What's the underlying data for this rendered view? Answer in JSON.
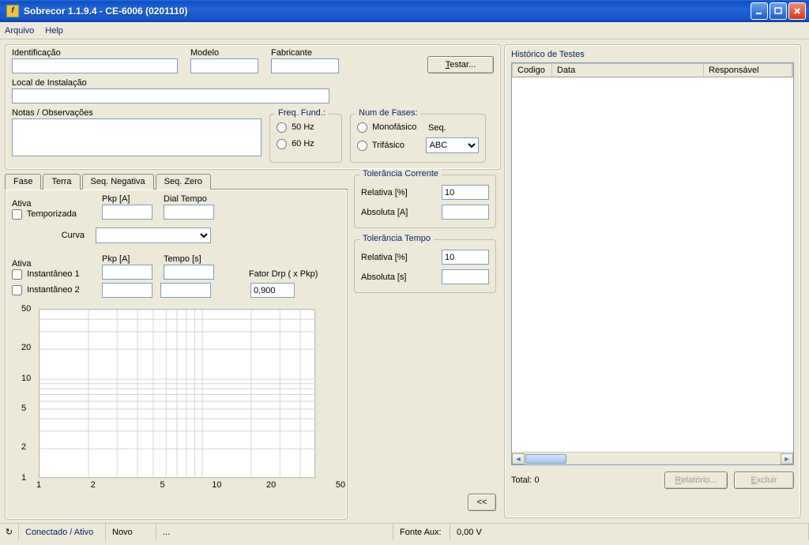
{
  "window": {
    "title": "Sobrecor 1.1.9.4 - CE-6006 (0201110)"
  },
  "menu": {
    "arquivo": "Arquivo",
    "help": "Help"
  },
  "ident": {
    "identificacao_label": "Identificação",
    "identificacao_value": "",
    "modelo_label": "Modelo",
    "modelo_value": "",
    "fabricante_label": "Fabricante",
    "fabricante_value": "",
    "testar_label": "Testar...",
    "local_label": "Local de Instalação",
    "local_value": "",
    "notas_label": "Notas / Observações",
    "notas_value": ""
  },
  "freq": {
    "group": "Freq. Fund.:",
    "opt50": "50 Hz",
    "opt60": "60 Hz"
  },
  "fases": {
    "group": "Num de Fases:",
    "mono": "Monofásico",
    "tri": "Trifásico",
    "seq_label": "Seq.",
    "seq_value": "ABC"
  },
  "tol_cor": {
    "group": "Tolerância Corrente",
    "relativa": "Relativa [%]",
    "relativa_v": "10",
    "absoluta": "Absoluta [A]",
    "absoluta_v": ""
  },
  "tol_tempo": {
    "group": "Tolerância Tempo",
    "relativa": "Relativa [%]",
    "relativa_v": "10",
    "absoluta": "Absoluta [s]",
    "absoluta_v": ""
  },
  "tabs": {
    "fase": "Fase",
    "terra": "Terra",
    "seqneg": "Seq. Negativa",
    "seqzero": "Seq. Zero"
  },
  "phase": {
    "ativa1": "Ativa",
    "temporizada": "Temporizada",
    "pkp": "Pkp [A]",
    "dial": "Dial Tempo",
    "curva": "Curva",
    "ativa2": "Ativa",
    "inst1": "Instantâneo 1",
    "inst2": "Instantâneo 2",
    "tempo": "Tempo [s]",
    "fatordrp": "Fator Drp ( x Pkp)",
    "fatordrp_v": "0,900",
    "collapse": "<<"
  },
  "history": {
    "group": "Histórico de Testes",
    "col_codigo": "Codigo",
    "col_data": "Data",
    "col_resp": "Responsável",
    "total": "Total: 0",
    "relatorio": "Relatório...",
    "excluir": "Excluir"
  },
  "status": {
    "conectado": "Conectado / Ativo",
    "novo": "Novo",
    "dots": "...",
    "fonteaux": "Fonte Aux:",
    "fonteaux_v": "0,00 V"
  },
  "chart_data": {
    "type": "line",
    "x": [
      1,
      2,
      5,
      10,
      20,
      50
    ],
    "y": [
      1,
      2,
      5,
      10,
      20,
      50
    ],
    "xscale": "log",
    "yscale": "log",
    "series": [],
    "xlim": [
      1,
      50
    ],
    "ylim": [
      1,
      50
    ],
    "xticks": [
      1,
      2,
      5,
      10,
      20,
      50
    ],
    "yticks": [
      1,
      2,
      5,
      10,
      20,
      50
    ]
  }
}
